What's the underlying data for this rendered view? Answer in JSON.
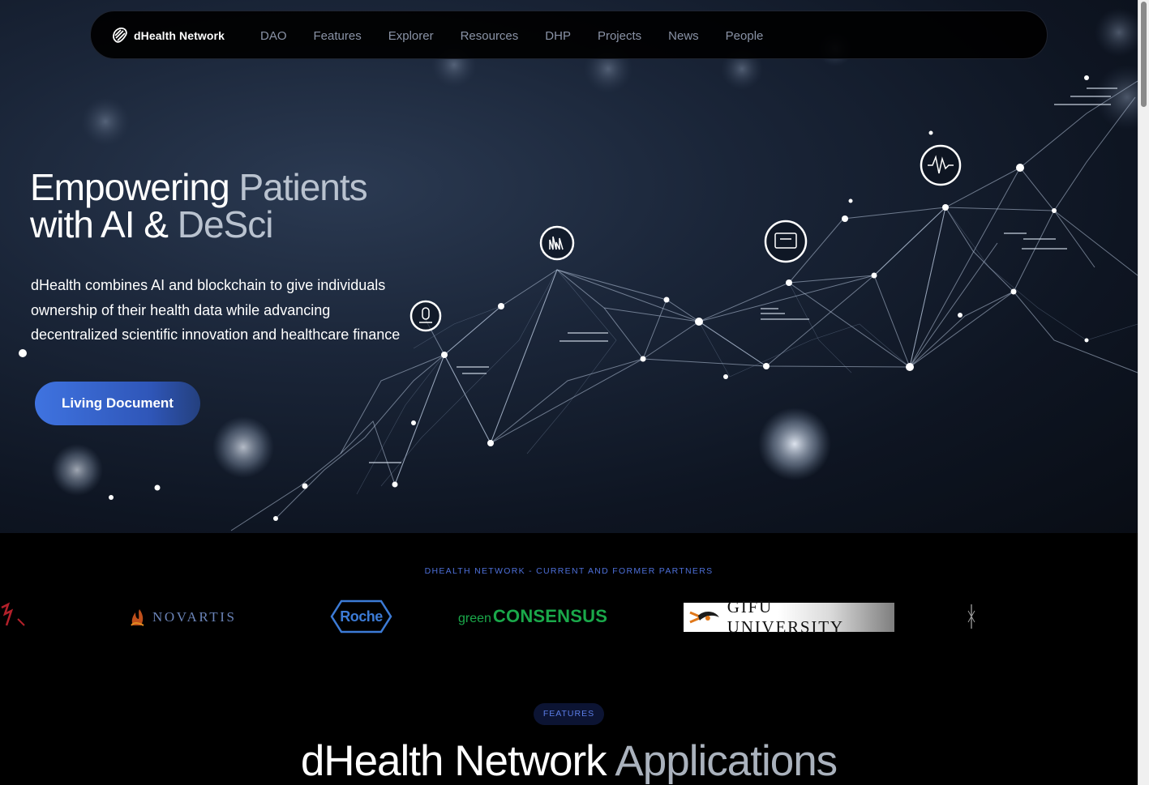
{
  "brand": {
    "name": "dHealth Network"
  },
  "nav": {
    "items": [
      {
        "label": "DAO"
      },
      {
        "label": "Features"
      },
      {
        "label": "Explorer"
      },
      {
        "label": "Resources"
      },
      {
        "label": "DHP"
      },
      {
        "label": "Projects"
      },
      {
        "label": "News"
      },
      {
        "label": "People"
      }
    ]
  },
  "hero": {
    "title_line1_a": "Empowering ",
    "title_line1_b": "Patients",
    "title_line2_a": "with AI & ",
    "title_line2_b": "DeSci",
    "description": "dHealth combines AI and blockchain to give individuals ownership of their health data while advancing decentralized scientific innovation and healthcare finance",
    "cta_label": "Living Document"
  },
  "partners": {
    "label": "dHealth Network - Current and Former Partners",
    "logos": {
      "novartis": "NOVARTIS",
      "roche": "Roche",
      "green_small": "green",
      "green_big": "CONSENSUS",
      "gifu": "GIFU UNIVERSITY"
    }
  },
  "features": {
    "badge": "FEATURES",
    "title_a": "dHealth Network ",
    "title_b": "Applications"
  },
  "colors": {
    "accent": "#3f73e0",
    "label_blue": "#4d6fd8",
    "nav_text": "#8a93a6",
    "background": "#000000"
  }
}
